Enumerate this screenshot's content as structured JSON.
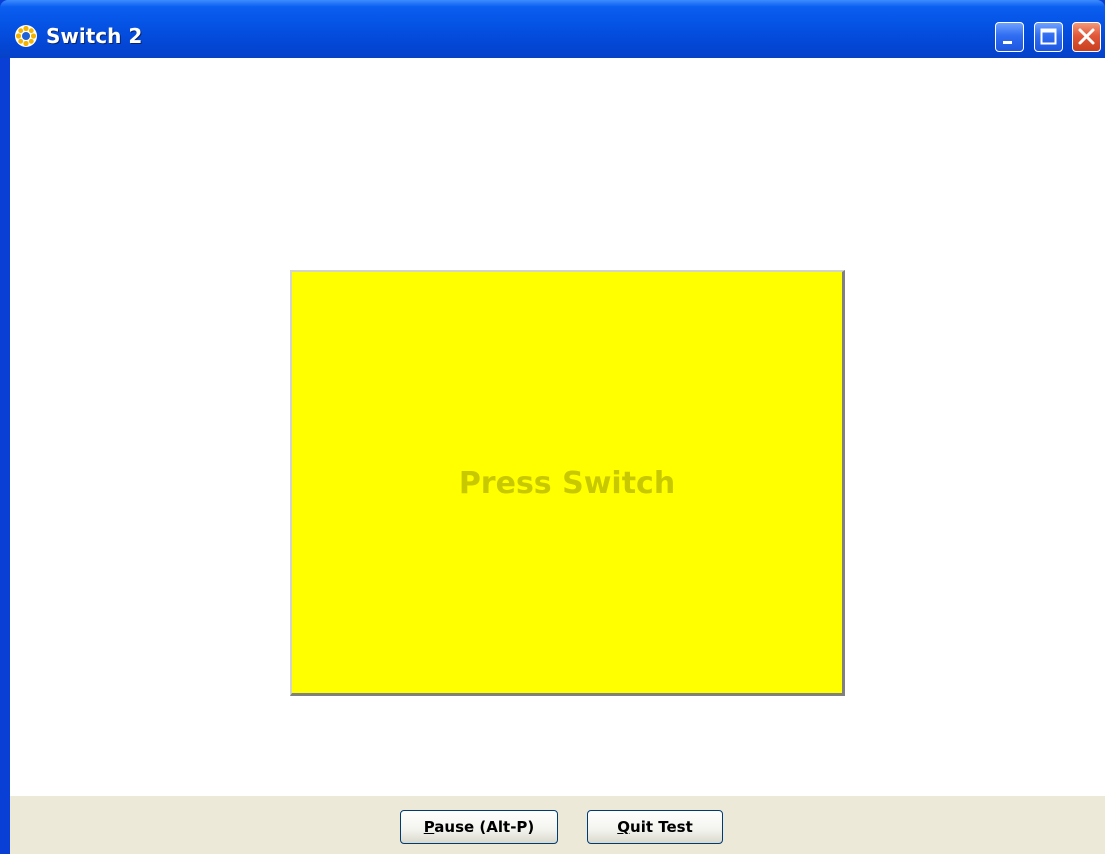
{
  "window": {
    "title": "Switch 2",
    "app_icon": "gear-icon",
    "controls": {
      "minimize_icon": "minimize-icon",
      "maximize_icon": "maximize-icon",
      "close_icon": "close-icon"
    },
    "colors": {
      "titlebar": "#0554e6",
      "close_button": "#e2573a"
    }
  },
  "main": {
    "switch_label": "Press Switch",
    "switch_color": "#ffff00",
    "switch_text_color": "#c8c800"
  },
  "footer": {
    "pause_button": {
      "mnemonic": "P",
      "label_rest": "ause (Alt-P)"
    },
    "quit_button": {
      "mnemonic": "Q",
      "label_rest": "uit Test"
    },
    "background": "#ece9d8"
  }
}
